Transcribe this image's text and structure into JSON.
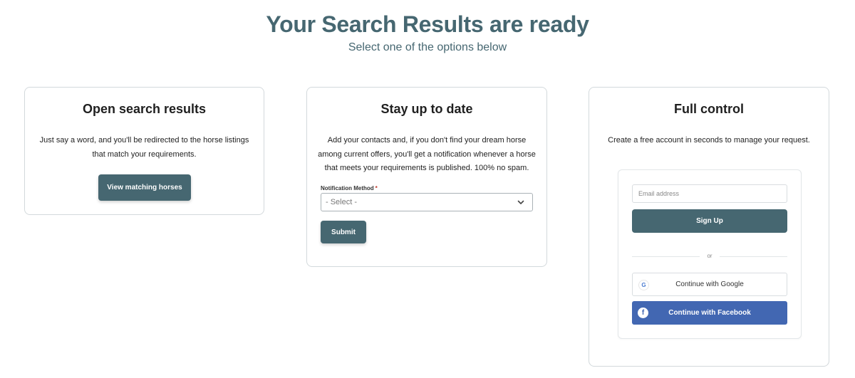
{
  "header": {
    "title": "Your Search Results are ready",
    "subtitle": "Select one of the options below"
  },
  "open_results": {
    "title": "Open search results",
    "text_line1": "Just say a word, and you'll be redirected to the horse listings",
    "text_line2": "that match your requirements.",
    "button_label": "View matching horses"
  },
  "stay_updated": {
    "title": "Stay up to date",
    "text_line1": "Add your contacts and, if you don't find your dream horse",
    "text_line2": "among current offers, you'll get a notification whenever a horse",
    "text_line3": "that meets your requirements is published. 100% no spam.",
    "field_label": "Notification Method",
    "required_mark": "*",
    "select_value": "- Select -",
    "submit_label": "Submit"
  },
  "full_control": {
    "title": "Full control",
    "text": "Create a free account in seconds to manage your request.",
    "email_placeholder": "Email address",
    "signup_label": "Sign Up",
    "divider_text": "or",
    "google_icon": "G",
    "google_label": "Continue with Google",
    "facebook_icon": "f",
    "facebook_label": "Continue with Facebook"
  },
  "colors": {
    "accent": "#466771",
    "facebook": "#4267b2"
  },
  "icons": {
    "select_chevron": "chevron-down-icon",
    "google": "google-icon",
    "facebook": "facebook-icon"
  }
}
